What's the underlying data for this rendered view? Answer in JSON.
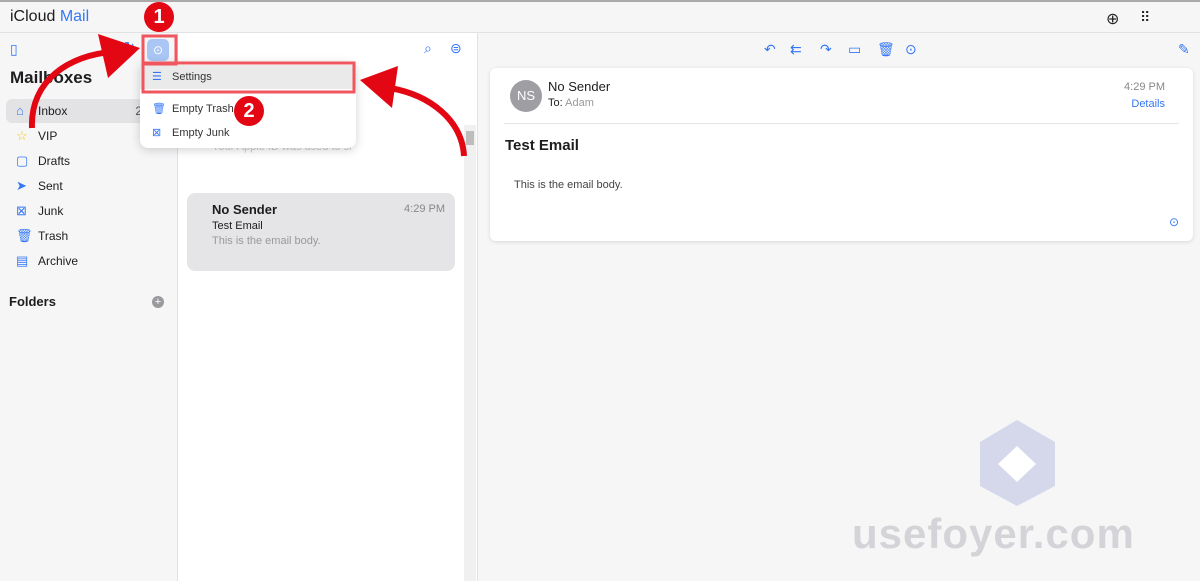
{
  "app": {
    "brand": "iCloud",
    "product": "Mail"
  },
  "sidebar": {
    "title": "Mailboxes",
    "items": [
      {
        "label": "Inbox",
        "icon": "inbox-icon",
        "count": "2",
        "selected": true
      },
      {
        "label": "VIP",
        "icon": "star-icon"
      },
      {
        "label": "Drafts",
        "icon": "document-icon"
      },
      {
        "label": "Sent",
        "icon": "paper-plane-icon"
      },
      {
        "label": "Junk",
        "icon": "junk-icon"
      },
      {
        "label": "Trash",
        "icon": "trash-icon"
      },
      {
        "label": "Archive",
        "icon": "archive-icon"
      }
    ],
    "folders_label": "Folders"
  },
  "menu": {
    "items": [
      {
        "label": "Settings",
        "icon": "sliders-icon"
      },
      {
        "label": "Empty Trash",
        "icon": "trash-icon"
      },
      {
        "label": "Empty Junk",
        "icon": "junk-icon"
      }
    ]
  },
  "list": {
    "faded_preview": "Your Apple ID was used to si",
    "messages": [
      {
        "from": "No Sender",
        "time": "4:29 PM",
        "subject": "Test Email",
        "preview": "This is the email body."
      }
    ]
  },
  "reader": {
    "initials": "NS",
    "sender": "No Sender",
    "to_label": "To:",
    "to": "Adam",
    "time": "4:29 PM",
    "details": "Details",
    "subject": "Test Email",
    "body": "This is the email body."
  },
  "annotations": {
    "step1": "1",
    "step2": "2",
    "color": "#e30613"
  },
  "watermark": "usefoyer.com",
  "colors": {
    "accent": "#3478f6"
  }
}
